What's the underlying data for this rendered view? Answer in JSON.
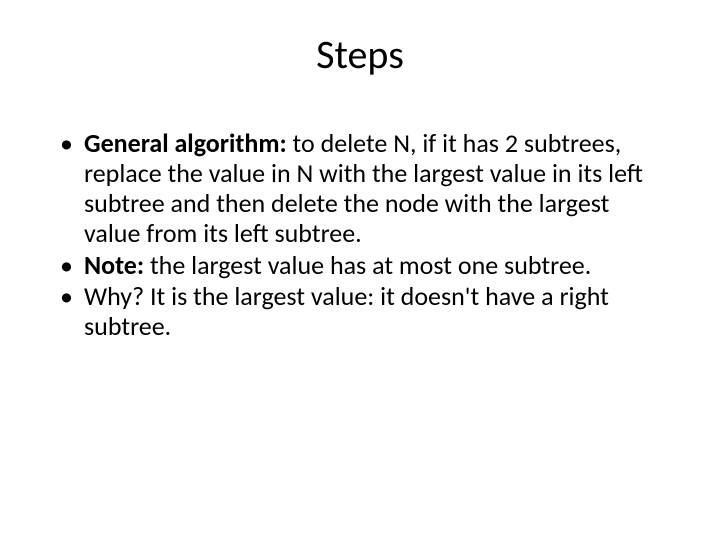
{
  "title": "Steps",
  "bullets": [
    {
      "bold": "General algorithm: ",
      "rest": "to delete N, if it has 2 subtrees, replace the value in N with the largest value in its left subtree and then delete the node with the largest value from its left subtree."
    },
    {
      "bold": "Note: ",
      "rest": "the largest value has at most one subtree."
    },
    {
      "bold": "",
      "rest": "Why? It is the largest value: it doesn't have a right subtree."
    }
  ]
}
